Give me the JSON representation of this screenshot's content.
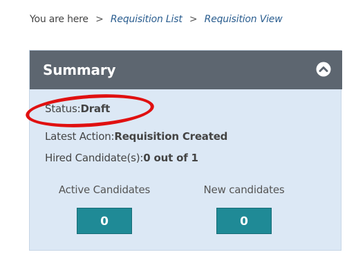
{
  "breadcrumb": {
    "prefix": "You are here",
    "separator": ">",
    "items": [
      "Requisition List",
      "Requisition View"
    ]
  },
  "summary": {
    "title": "Summary",
    "collapse_icon": "chevron-up-circle-icon",
    "status_label": "Status:",
    "status_value": "Draft",
    "latest_action_label": "Latest Action:",
    "latest_action_value": "Requisition Created",
    "hired_label": "Hired Candidate(s):",
    "hired_value": "0 out of 1",
    "active_candidates_label": "Active Candidates",
    "active_candidates_count": "0",
    "new_candidates_label": "New candidates",
    "new_candidates_count": "0"
  },
  "colors": {
    "header_bg": "#5d6670",
    "panel_bg": "#dce8f5",
    "counter_bg": "#1f8a96",
    "highlight": "#e01010",
    "link": "#2a5d8f"
  }
}
